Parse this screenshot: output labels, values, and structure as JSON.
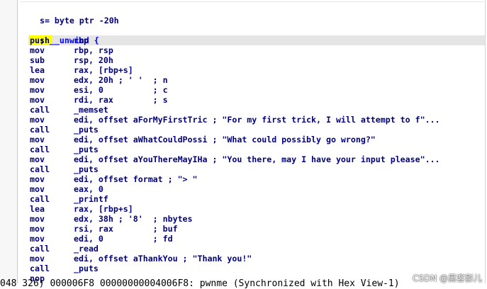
{
  "header_line": "s= byte ptr -20h",
  "unwind_comment": "; __unwind {",
  "listing": [
    {
      "mn": "push",
      "op": "rbp",
      "cm": ""
    },
    {
      "mn": "mov",
      "op": "rbp, rsp",
      "cm": ""
    },
    {
      "mn": "sub",
      "op": "rsp, 20h",
      "cm": ""
    },
    {
      "mn": "lea",
      "op": "rax, [rbp+s]",
      "cm": ""
    },
    {
      "mn": "mov",
      "op": "edx, 20h ; ' '  ; n",
      "cm": ""
    },
    {
      "mn": "mov",
      "op": "esi, 0          ; c",
      "cm": ""
    },
    {
      "mn": "mov",
      "op": "rdi, rax        ; s",
      "cm": ""
    },
    {
      "mn": "call",
      "op": "_memset",
      "cm": ""
    },
    {
      "mn": "mov",
      "op": "edi, offset aForMyFirstTric ; \"For my first trick, I will attempt to f\"...",
      "cm": ""
    },
    {
      "mn": "call",
      "op": "_puts",
      "cm": ""
    },
    {
      "mn": "mov",
      "op": "edi, offset aWhatCouldPossi ; \"What could possibly go wrong?\"",
      "cm": ""
    },
    {
      "mn": "call",
      "op": "_puts",
      "cm": ""
    },
    {
      "mn": "mov",
      "op": "edi, offset aYouThereMayIHa ; \"You there, may I have your input please\"...",
      "cm": ""
    },
    {
      "mn": "call",
      "op": "_puts",
      "cm": ""
    },
    {
      "mn": "mov",
      "op": "edi, offset format ; \"> \"",
      "cm": ""
    },
    {
      "mn": "mov",
      "op": "eax, 0",
      "cm": ""
    },
    {
      "mn": "call",
      "op": "_printf",
      "cm": ""
    },
    {
      "mn": "lea",
      "op": "rax, [rbp+s]",
      "cm": ""
    },
    {
      "mn": "mov",
      "op": "edx, 38h ; '8'  ; nbytes",
      "cm": ""
    },
    {
      "mn": "mov",
      "op": "rsi, rax        ; buf",
      "cm": ""
    },
    {
      "mn": "mov",
      "op": "edi, 0          ; fd",
      "cm": ""
    },
    {
      "mn": "call",
      "op": "_read",
      "cm": ""
    },
    {
      "mn": "mov",
      "op": "edi, offset aThankYou ; \"Thank you!\"",
      "cm": ""
    },
    {
      "mn": "call",
      "op": "_puts",
      "cm": ""
    },
    {
      "mn": "nop",
      "op": "",
      "cm": ""
    }
  ],
  "status_bar": "048 326) 000006F8 00000000004006F8: pwnme (Synchronized with Hex View-1)",
  "watermark": "CSDN @黑客影儿",
  "colors": {
    "mnemonic": "#000080",
    "number": "#008040",
    "comment": "#808080",
    "cursor": "#ffff00"
  }
}
